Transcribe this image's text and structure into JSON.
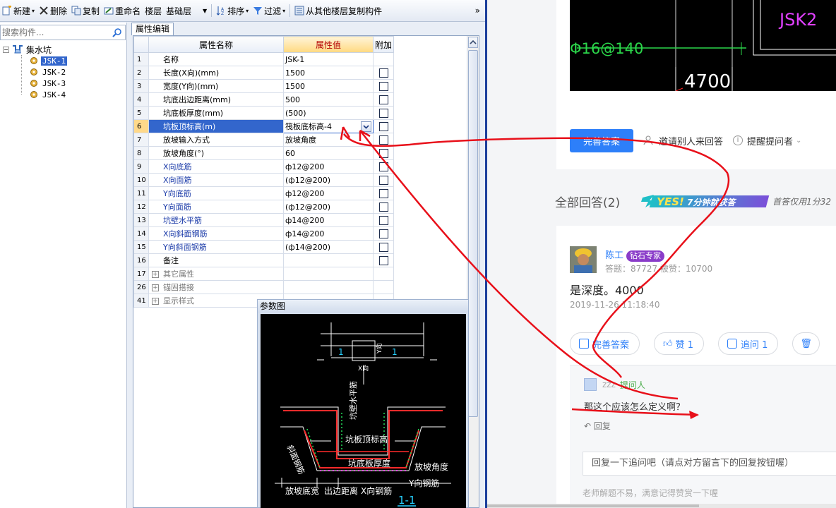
{
  "toolbar": {
    "new_label": "新建",
    "delete_label": "删除",
    "copy_label": "复制",
    "rename_label": "重命名",
    "floor_label": "楼层",
    "floor_value": "基础层",
    "sort_label": "排序",
    "filter_label": "过滤",
    "copy_from_floor_label": "从其他楼层复制构件",
    "more_label": "»"
  },
  "component_panel": {
    "search_placeholder": "搜索构件...",
    "root_label": "集水坑",
    "items": [
      "JSK-1",
      "JSK-2",
      "JSK-3",
      "JSK-4"
    ],
    "selected_index": 0
  },
  "property_editor": {
    "tab_label": "属性编辑",
    "headers": {
      "name": "属性名称",
      "value": "属性值",
      "extra": "附加"
    },
    "rows": [
      {
        "num": "1",
        "name": "名称",
        "value": "JSK-1",
        "style": "normal",
        "checkbox": false
      },
      {
        "num": "2",
        "name": "长度(X向)(mm)",
        "value": "1500",
        "style": "normal",
        "checkbox": true
      },
      {
        "num": "3",
        "name": "宽度(Y向)(mm)",
        "value": "1500",
        "style": "normal",
        "checkbox": true
      },
      {
        "num": "4",
        "name": "坑底出边距离(mm)",
        "value": "500",
        "style": "normal",
        "checkbox": true
      },
      {
        "num": "5",
        "name": "坑底板厚度(mm)",
        "value": "(500)",
        "style": "normal",
        "checkbox": true
      },
      {
        "num": "6",
        "name": "坑板顶标高(m)",
        "value": "筏板底标高-4",
        "style": "current",
        "checkbox": true
      },
      {
        "num": "7",
        "name": "放坡输入方式",
        "value": "放坡角度",
        "style": "normal",
        "checkbox": true
      },
      {
        "num": "8",
        "name": "放坡角度(°)",
        "value": "60",
        "style": "normal",
        "checkbox": true
      },
      {
        "num": "9",
        "name": "X向底筋",
        "value": "ф12@200",
        "style": "blue",
        "checkbox": true
      },
      {
        "num": "10",
        "name": "X向面筋",
        "value": "(ф12@200)",
        "style": "blue",
        "checkbox": true
      },
      {
        "num": "11",
        "name": "Y向底筋",
        "value": "ф12@200",
        "style": "blue",
        "checkbox": true
      },
      {
        "num": "12",
        "name": "Y向面筋",
        "value": "(ф12@200)",
        "style": "blue",
        "checkbox": true
      },
      {
        "num": "13",
        "name": "坑壁水平筋",
        "value": "ф14@200",
        "style": "blue",
        "checkbox": true
      },
      {
        "num": "14",
        "name": "X向斜面钢筋",
        "value": "ф14@200",
        "style": "blue",
        "checkbox": true
      },
      {
        "num": "15",
        "name": "Y向斜面钢筋",
        "value": "(ф14@200)",
        "style": "blue",
        "checkbox": true
      },
      {
        "num": "16",
        "name": "备注",
        "value": "",
        "style": "normal",
        "checkbox": true
      },
      {
        "num": "17",
        "name": "其它属性",
        "value": "",
        "style": "group",
        "checkbox": false
      },
      {
        "num": "26",
        "name": "锚固搭接",
        "value": "",
        "style": "group",
        "checkbox": false
      },
      {
        "num": "41",
        "name": "显示样式",
        "value": "",
        "style": "group",
        "checkbox": false
      }
    ]
  },
  "diagram": {
    "title": "参数图",
    "labels": {
      "section_mark": "1",
      "x_dir": "X向",
      "y_dir": "Y向",
      "wall_rebar": "坑壁水平筋",
      "top_elev": "坑板顶标高",
      "bottom_thickness": "坑底板厚度",
      "slope_angle": "放坡角度",
      "slope_rebar": "斜面钢筋",
      "slope_width": "放坡底宽",
      "edge_distance": "出边距离",
      "x_rebar": "X向钢筋",
      "y_rebar": "Y向钢筋",
      "section_title": "1-1"
    }
  },
  "web": {
    "cad_text_1": "JSK2",
    "cad_text_2": "Φ16@140",
    "cad_text_3": "4700",
    "perfect_answer_button": "完善答案",
    "invite_label": "邀请别人来回答",
    "remind_label": "提醒提问者",
    "all_answers_title": "全部回答(2)",
    "promo_yes": "YES!",
    "promo_text": "7分钟就获答",
    "promo_note": "首答仅用1分32",
    "user_name": "陈工",
    "user_badge": "钻石专家",
    "user_stats": "答题：87727    被赞：10700",
    "answer_text": "是深度。4000",
    "answer_date": "2019-11-26 11:18:40",
    "edit_answer_button": "完善答案",
    "like_button": "赞 1",
    "followup_button": "追问  1",
    "followup_user": "zzz",
    "followup_role": "提问人",
    "followup_question": "那这个应该怎么定义啊？",
    "reply_link": "回复",
    "reply_input_text": "回复一下追问吧（请点对方留言下的回复按钮喔）",
    "tip_text": "老师解题不易，满意记得赞赏一下喔"
  },
  "colors": {
    "accent_blue": "#2d7ff9",
    "selection_blue": "#3366cc",
    "annotation_red": "#e8101a",
    "badge_purple": "#8a3cc9",
    "cad_magenta": "#e040ff",
    "cad_green": "#2bd64a"
  }
}
